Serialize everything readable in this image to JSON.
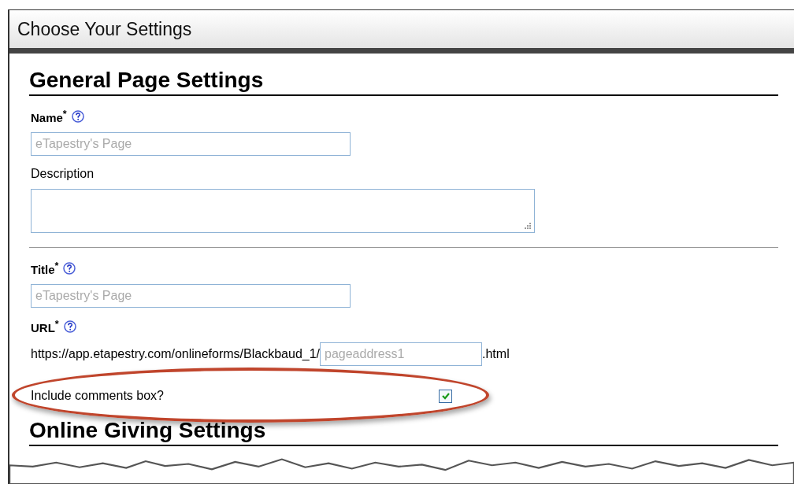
{
  "window": {
    "title": "Choose Your Settings"
  },
  "sections": [
    {
      "heading": "General Page Settings",
      "fields": [
        {
          "kind": "text",
          "label": "Name$^{*}$",
          "help": true,
          "placeholder": "eTapestry's Page"
        },
        {
          "kind": "textarea",
          "label": "Description",
          "help": false
        },
        {
          "kind": "divider"
        },
        {
          "kind": "text",
          "label": "Title$^{*}$",
          "help": true,
          "placeholder": "eTapestry's Page"
        },
        {
          "kind": "url",
          "label": "URL$^{*}$",
          "help": true,
          "prefix": "https://app.etapestry.com/onlineforms/Blackbaud_1/",
          "placeholder": "pageaddress1",
          "suffix": ".html"
        },
        {
          "kind": "checkbox",
          "label": "Include comments box?",
          "checked": true,
          "highlighted": true
        }
      ]
    },
    {
      "heading": "Online Giving Settings"
    }
  ]
}
